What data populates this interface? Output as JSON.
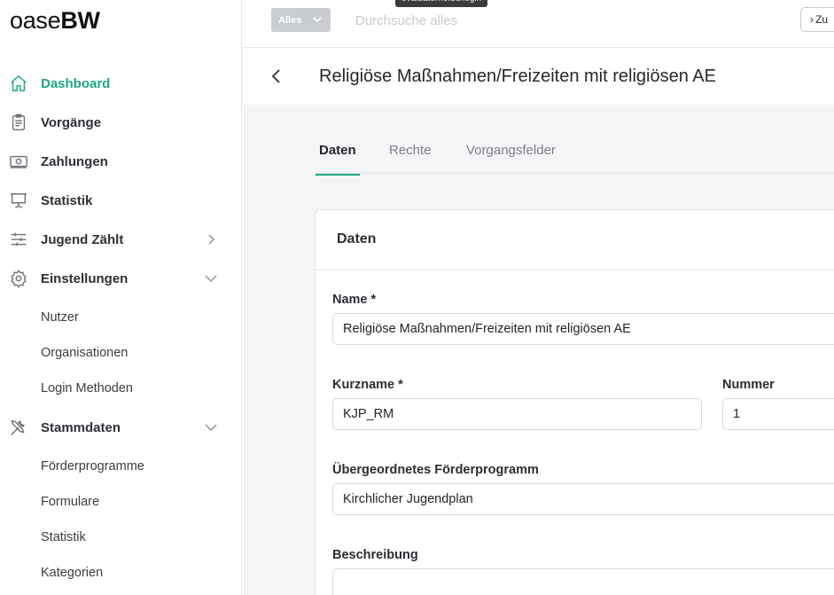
{
  "app": {
    "logo_light": "oase",
    "logo_bold": "BW"
  },
  "sidebar": {
    "items": [
      {
        "label": "Dashboard",
        "icon": "home-icon",
        "active": true
      },
      {
        "label": "Vorgänge",
        "icon": "clipboard-icon"
      },
      {
        "label": "Zahlungen",
        "icon": "cash-icon"
      },
      {
        "label": "Statistik",
        "icon": "presentation-icon"
      },
      {
        "label": "Jugend Zählt",
        "icon": "sliders-icon",
        "chevron": "right"
      },
      {
        "label": "Einstellungen",
        "icon": "gear-icon",
        "chevron": "down"
      },
      {
        "label": "Stammdaten",
        "icon": "tools-icon",
        "chevron": "down"
      }
    ],
    "einstellungen_sub": [
      "Nutzer",
      "Organisationen",
      "Login Methoden"
    ],
    "stammdaten_sub": [
      "Förderprogramme",
      "Formulare",
      "Statistik",
      "Kategorien"
    ]
  },
  "topbar": {
    "scope_label": "Alles",
    "search_placeholder": "Durchsuche alles",
    "tooltip": "evaluaterne.de/login",
    "zu_label": "Zu"
  },
  "page": {
    "title": "Religiöse Maßnahmen/Freizeiten mit religiösen AE"
  },
  "tabs": [
    "Daten",
    "Rechte",
    "Vorgangsfelder"
  ],
  "card": {
    "title": "Daten",
    "fields": {
      "name": {
        "label": "Name *",
        "value": "Religiöse Maßnahmen/Freizeiten mit religiösen AE"
      },
      "kurzname": {
        "label": "Kurzname *",
        "value": "KJP_RM"
      },
      "nummer": {
        "label": "Nummer",
        "value": "1"
      },
      "parent": {
        "label": "Übergeordnetes Förderprogramm",
        "value": "Kirchlicher Jugendplan"
      },
      "beschreibung": {
        "label": "Beschreibung",
        "value": ""
      }
    }
  },
  "colors": {
    "accent": "#1fa882",
    "scope_button": "#c9ccd1"
  }
}
